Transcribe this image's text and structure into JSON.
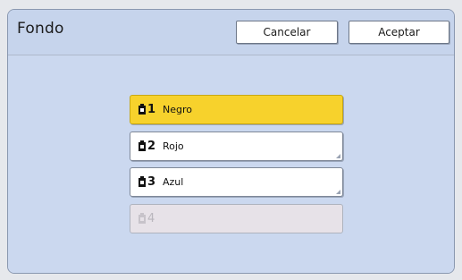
{
  "dialog": {
    "title": "Fondo",
    "cancel_label": "Cancelar",
    "accept_label": "Aceptar"
  },
  "items": [
    {
      "number": "1",
      "label": "Negro",
      "state": "selected"
    },
    {
      "number": "2",
      "label": "Rojo",
      "state": "normal"
    },
    {
      "number": "3",
      "label": "Azul",
      "state": "normal"
    },
    {
      "number": "4",
      "label": "",
      "state": "disabled"
    }
  ],
  "icons": {
    "drum": "ink-drum-icon"
  },
  "colors": {
    "selected": "#f7d22c",
    "panel": "#c9d7ee",
    "disabled": "#e7e2e8"
  }
}
